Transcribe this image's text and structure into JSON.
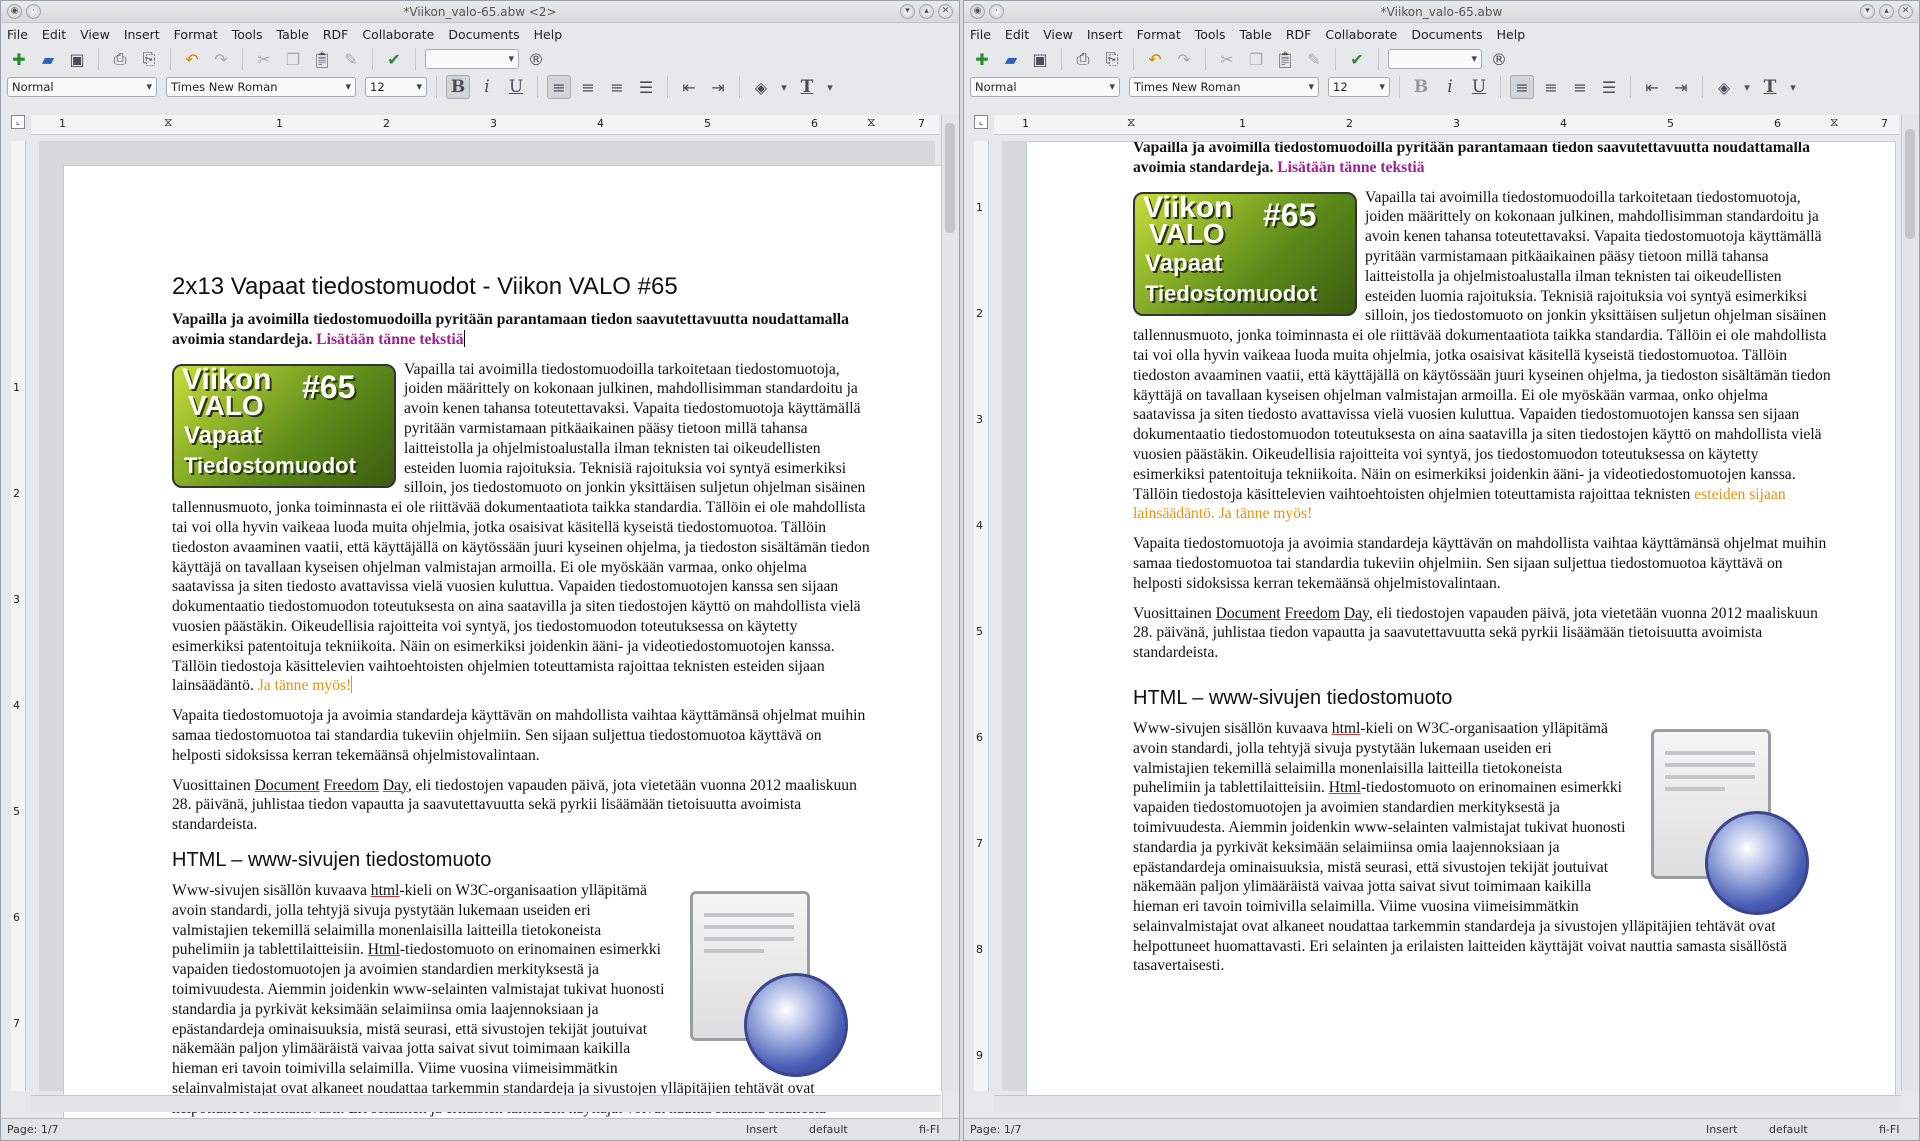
{
  "left_window": {
    "title": "*Viikon_valo-65.abw <2>",
    "status": {
      "page": "Page: 1/7",
      "mode": "Insert",
      "lang_default": "default",
      "locale": "fi-FI"
    }
  },
  "right_window": {
    "title": "*Viikon_valo-65.abw",
    "status": {
      "page": "Page: 1/7",
      "mode": "Insert",
      "lang_default": "default",
      "locale": "fi-FI"
    }
  },
  "menu": [
    "File",
    "Edit",
    "View",
    "Insert",
    "Format",
    "Tools",
    "Table",
    "RDF",
    "Collaborate",
    "Documents",
    "Help"
  ],
  "format": {
    "style": "Normal",
    "font": "Times New Roman",
    "size": "12"
  },
  "ruler": {
    "labels": [
      "1",
      "1",
      "2",
      "3",
      "4",
      "5",
      "6",
      "7"
    ]
  },
  "vruler": {
    "labels": [
      "1",
      "2",
      "3",
      "4",
      "5",
      "6",
      "7",
      "8",
      "9"
    ]
  },
  "doc": {
    "h1": "2x13 Vapaat tiedostomuodot - Viikon VALO #65",
    "lead_bold": "Vapailla ja avoimilla tiedostomuodoilla pyritään parantamaan tiedon saavutettavuutta noudattamalla avoimia standardeja.",
    "lead_magenta": " Lisätään tänne tekstiä",
    "logo": {
      "l1": "Viikon",
      "l2": "VALO",
      "l3": "#65",
      "l4": "Vapaat",
      "l5": "Tiedostomuodot"
    },
    "p1": "Vapailla tai avoimilla tiedostomuodoilla tarkoitetaan tiedostomuotoja, joiden määrittely on kokonaan julkinen, mahdollisimman standardoitu ja avoin kenen tahansa toteutettavaksi. Vapaita tiedostomuotoja käyttämällä pyritään varmistamaan pitkäaikainen pääsy tietoon millä tahansa laitteistolla ja ohjelmistoalustalla ilman teknisten tai oikeudellisten esteiden luomia rajoituksia. Teknisiä rajoituksia voi syntyä esimerkiksi silloin, jos tiedostomuoto on jonkin yksittäisen suljetun ohjelman sisäinen tallennusmuoto, jonka toiminnasta ei ole riittävää dokumentaatiota taikka standardia. Tällöin ei ole mahdollista tai voi olla hyvin vaikeaa luoda muita ohjelmia, jotka osaisivat käsitellä kyseistä tiedostomuotoa. Tällöin tiedoston avaaminen vaatii, että käyttäjällä on käytössään juuri kyseinen ohjelma, ja tiedoston sisältämän tiedon käyttäjä on tavallaan kyseisen ohjelman valmistajan armoilla. Ei ole myöskään varmaa, onko ohjelma saatavissa ja siten tiedosto avattavissa vielä vuosien kuluttua. Vapaiden tiedostomuotojen kanssa sen sijaan dokumentaatio tiedostomuodon toteutuksesta on aina saatavilla ja siten tiedostojen käyttö on mahdollista vielä vuosien päästäkin. Oikeudellisia rajoitteita voi syntyä, jos tiedostomuodon toteutuksessa on käytetty esimerkiksi patentoituja tekniikoita. Näin on esimerkiksi joidenkin ääni- ja videotiedostomuotojen kanssa. Tällöin tiedostoja käsittelevien vaihtoehtoisten ohjelmien toteuttamista rajoittaa teknisten",
    "p1_tail": "esteiden sijaan lainsäädäntö.",
    "p1_orange": " Ja tänne myös!",
    "p2": "Vapaita tiedostomuotoja ja avoimia standardeja käyttävän on mahdollista vaihtaa käyttämänsä ohjelmat muihin samaa tiedostomuotoa tai standardia tukeviin ohjelmiin. Sen sijaan suljettua tiedostomuotoa käyttävä on helposti sidoksissa kerran tekemäänsä ohjelmistovalintaan.",
    "p3_a": "Vuosittainen ",
    "p3_u1": "Document",
    "p3_s1": " ",
    "p3_u2": "Freedom",
    "p3_s2": " ",
    "p3_u3": "Day",
    "p3_b": ", eli tiedostojen vapauden päivä, jota vietetään vuonna 2012 maaliskuun 28. päivänä, juhlistaa tiedon vapautta ja saavutettavuutta sekä pyrkii lisäämään tietoisuutta avoimista standardeista.",
    "h2": "HTML – www-sivujen tiedostomuoto",
    "p4_a": "Www-sivujen sisällön kuvaava ",
    "p4_u1": "html",
    "p4_b": "-kieli on W3C-organisaation ylläpitämä avoin standardi, jolla tehtyjä sivuja pystytään lukemaan useiden eri valmistajien tekemillä selaimilla monenlaisilla laitteilla tietokoneista puhelimiin ja tablettilaitteisiin. ",
    "p4_u2": "Html",
    "p4_c": "-tiedostomuoto on erinomainen esimerkki vapaiden tiedostomuotojen ja avoimien standardien merkityksestä ja toimivuudesta. Aiemmin joidenkin www-selainten valmistajat tukivat huonosti standardia ja pyrkivät keksimään selaimiinsa omia laajennoksiaan ja epästandardeja ominaisuuksia, mistä seurasi, että sivustojen tekijät joutuivat näkemään paljon ylimääräistä vaivaa jotta saivat sivut toimimaan kaikilla hieman eri tavoin toimivilla selaimilla. Viime vuosina viimeisimmätkin selainvalmistajat ovat alkaneet noudattaa tarkemmin standardeja ja sivustojen ylläpitäjien tehtävät ovat helpottuneet huomattavasti. Eri selainten ja erilaisten laitteiden käyttäjät voivat nauttia samasta sisällöstä tasavertaisesti.",
    "p1_tail_right": "esteiden sijaan lainsäädäntö."
  }
}
